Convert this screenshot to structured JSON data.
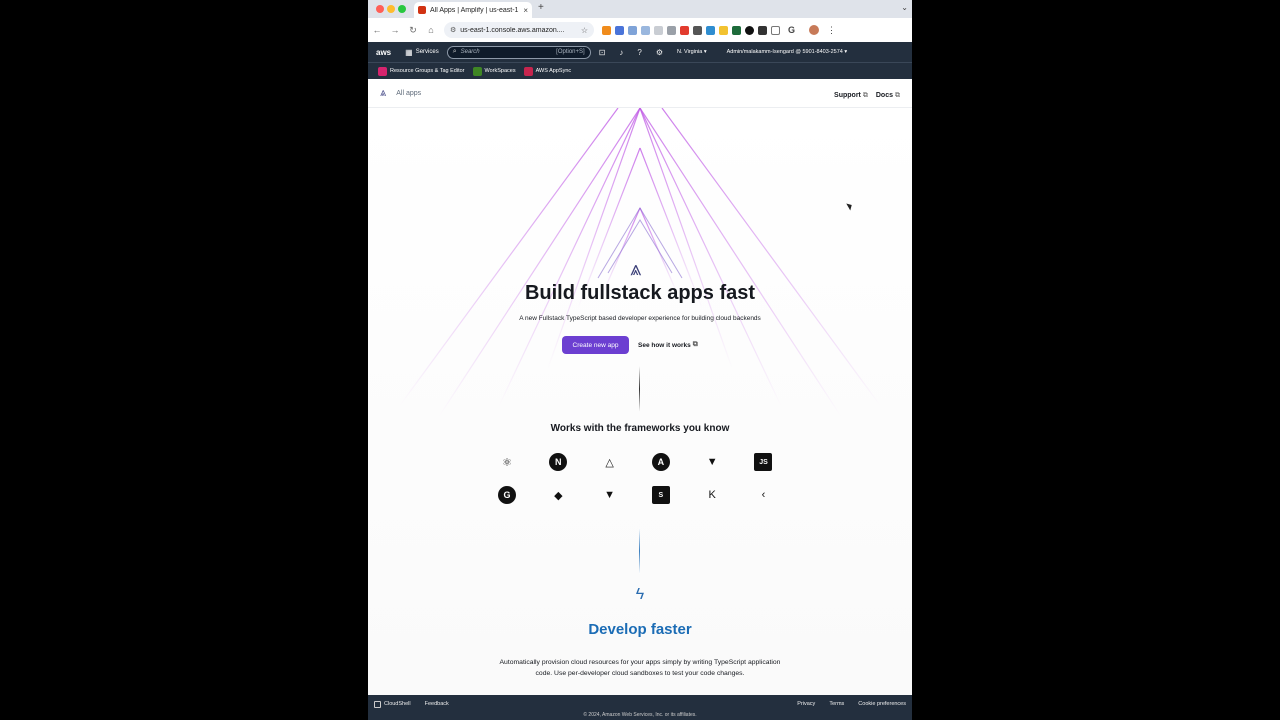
{
  "browser": {
    "tab_title": "All Apps | Amplify | us-east-1",
    "url": "us-east-1.console.aws.amazon....",
    "new_tab": "+"
  },
  "aws_nav": {
    "logo": "aws",
    "services": "Services",
    "search_placeholder": "Search",
    "search_shortcut": "[Option+S]",
    "region": "N. Virginia ▾",
    "account": "Admin/malakamm-Isengard @ 5901-8403-2574 ▾"
  },
  "favorites": [
    {
      "label": "Resource Groups & Tag Editor",
      "color": "#d6246e"
    },
    {
      "label": "WorkSpaces",
      "color": "#3f8624"
    },
    {
      "label": "AWS AppSync",
      "color": "#c7254e"
    }
  ],
  "page_header": {
    "all_apps": "All apps",
    "support": "Support",
    "docs": "Docs"
  },
  "hero": {
    "title": "Build fullstack apps fast",
    "subtitle": "A new Fullstack TypeScript based developer experience for building cloud backends",
    "create_button": "Create new app",
    "how_button": "See how it works"
  },
  "frameworks": {
    "title": "Works with the frameworks you know",
    "icons": [
      {
        "name": "react-icon",
        "glyph": "⚛",
        "style": "plain"
      },
      {
        "name": "nextjs-icon",
        "glyph": "N",
        "style": "round"
      },
      {
        "name": "nuxt-icon",
        "glyph": "△",
        "style": "plain"
      },
      {
        "name": "angular-icon",
        "glyph": "A",
        "style": "round"
      },
      {
        "name": "vue-icon",
        "glyph": "▼",
        "style": "plain"
      },
      {
        "name": "javascript-icon",
        "glyph": "JS",
        "style": "sq"
      },
      {
        "name": "gatsby-icon",
        "glyph": "G",
        "style": "round"
      },
      {
        "name": "ionic-icon",
        "glyph": "◆",
        "style": "plain"
      },
      {
        "name": "vite-icon",
        "glyph": "▼",
        "style": "plain"
      },
      {
        "name": "swift-icon",
        "glyph": "S",
        "style": "sq"
      },
      {
        "name": "kotlin-icon",
        "glyph": "K",
        "style": "plain"
      },
      {
        "name": "flutter-icon",
        "glyph": "‹",
        "style": "plain"
      }
    ]
  },
  "develop": {
    "title": "Develop faster",
    "text": "Automatically provision cloud resources for your apps simply by writing TypeScript application code. Use per-developer cloud sandboxes to test your code changes."
  },
  "footer": {
    "cloudshell": "CloudShell",
    "feedback": "Feedback",
    "privacy": "Privacy",
    "terms": "Terms",
    "cookies": "Cookie preferences",
    "copyright": "© 2024, Amazon Web Services, Inc. or its affiliates."
  }
}
